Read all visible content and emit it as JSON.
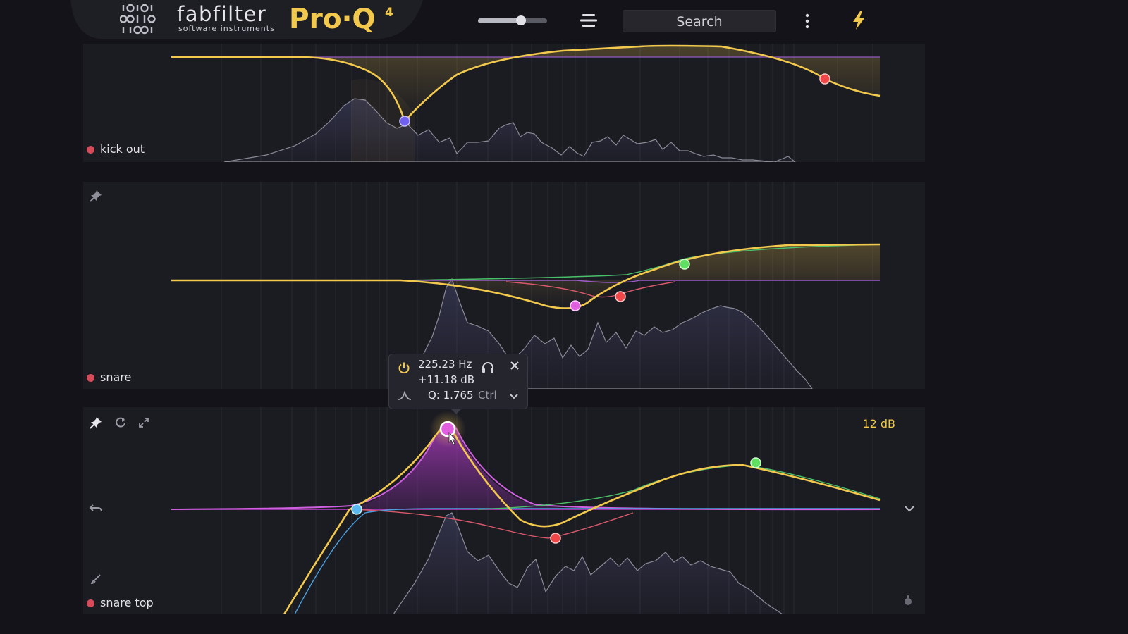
{
  "header": {
    "brand_name": "fabfilter",
    "brand_sub": "software instruments",
    "product": "Pro·Q",
    "product_version": "4",
    "output_level": 0.62,
    "search_placeholder": "Search",
    "accent_color": "#f2c94c"
  },
  "icons": {
    "logo": "fabfilter-binary-logo",
    "menu": "hamburger-menu-icon",
    "more": "kebab-menu-icon",
    "performance": "lightning-icon",
    "pin": "pin-icon",
    "refresh": "refresh-icon",
    "expand": "expand-icon",
    "undo": "undo-icon",
    "brush": "brush-icon",
    "power": "power-icon",
    "solo": "headphones-icon",
    "close": "close-icon",
    "filter_shape": "bell-shape-icon",
    "chevron": "chevron-down-icon"
  },
  "tracks": [
    {
      "name": "kick out",
      "dot_color": "#d64a5a"
    },
    {
      "name": "snare",
      "dot_color": "#d64a5a"
    },
    {
      "name": "snare top",
      "dot_color": "#d64a5a",
      "gain_scale": "12 dB"
    }
  ],
  "band_popup": {
    "frequency": "225.23 Hz",
    "gain": "+11.18 dB",
    "q": "Q: 1.765",
    "modifier": "Ctrl"
  },
  "band_colors": {
    "eq_curve": "#f2c94c",
    "band_blue": "#5ab8f0",
    "band_pink": "#e060e0",
    "band_red": "#f04848",
    "band_green": "#60e060",
    "band_purple": "#7060f0"
  }
}
